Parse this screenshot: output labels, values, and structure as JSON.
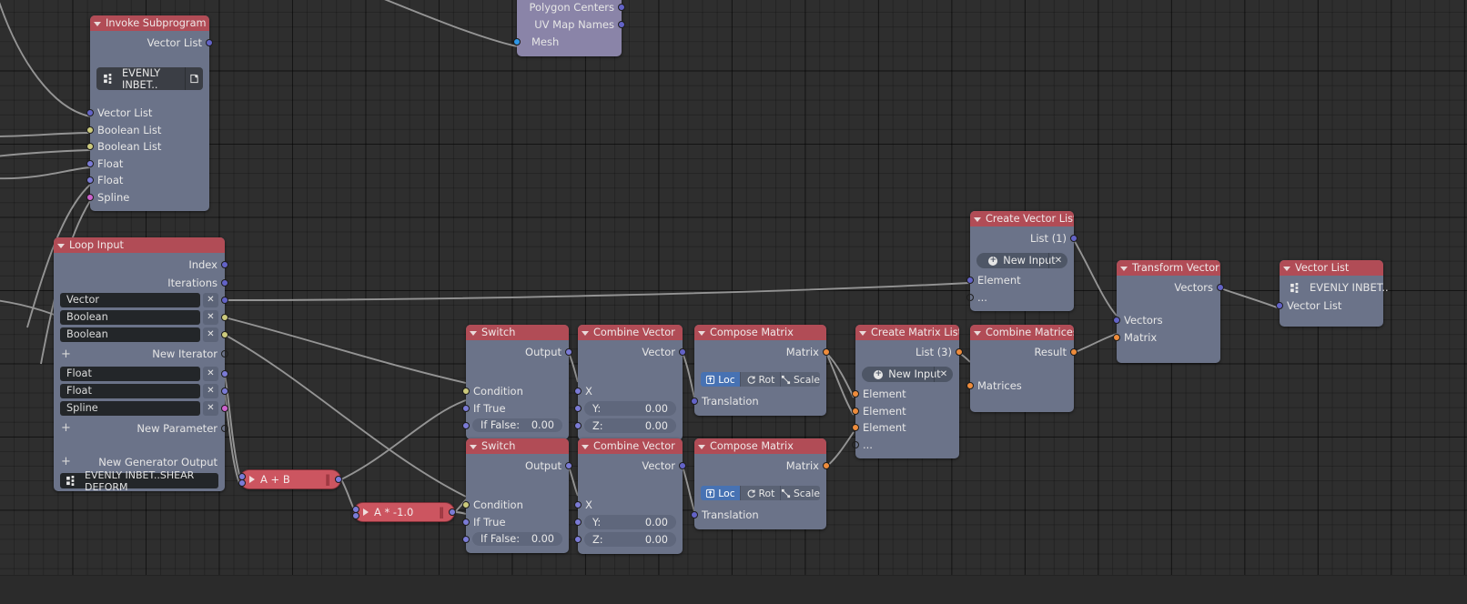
{
  "editor": {
    "name": "blender-animation-nodes-editor",
    "background_color": "#2e2e2e",
    "node_header_color": "#b14c56",
    "node_body_color": "#6b7389",
    "selected_node_body_color": "#8a84a8",
    "accent_blue": "#4772b3"
  },
  "nodes": {
    "mesh_source": {
      "title": "",
      "rows": [
        "Polygon Centers",
        "UV Map Names",
        "Mesh"
      ]
    },
    "invoke_subprogram": {
      "title": "Invoke Subprogram",
      "output": "Vector List",
      "subprogram": "EVENLY INBET..",
      "inputs": [
        "Vector List",
        "Boolean List",
        "Boolean List",
        "Float",
        "Float",
        "Spline"
      ]
    },
    "loop_input": {
      "title": "Loop Input",
      "outputs": [
        "Index",
        "Iterations"
      ],
      "iterators": [
        "Vector",
        "Boolean",
        "Boolean"
      ],
      "new_iterator": "New Iterator",
      "parameters": [
        "Float",
        "Float",
        "Spline"
      ],
      "new_parameter": "New Parameter",
      "new_generator_output": "New Generator Output",
      "footer": "EVENLY INBET..SHEAR DEFORM",
      "remove_label": "✕",
      "plus_label": "+"
    },
    "math_add": {
      "label": "A + B"
    },
    "math_mul": {
      "label": "A * -1.0"
    },
    "switch_1": {
      "title": "Switch",
      "output": "Output",
      "condition": "Condition",
      "if_true": "If True",
      "if_false_label": "If False:",
      "if_false_value": "0.00"
    },
    "switch_2": {
      "title": "Switch",
      "output": "Output",
      "condition": "Condition",
      "if_true": "If True",
      "if_false_label": "If False:",
      "if_false_value": "0.00"
    },
    "combine_vector_1": {
      "title": "Combine Vector",
      "output": "Vector",
      "x_label": "X",
      "y_label": "Y:",
      "y_value": "0.00",
      "z_label": "Z:",
      "z_value": "0.00"
    },
    "combine_vector_2": {
      "title": "Combine Vector",
      "output": "Vector",
      "x_label": "X",
      "y_label": "Y:",
      "y_value": "0.00",
      "z_label": "Z:",
      "z_value": "0.00"
    },
    "compose_matrix_1": {
      "title": "Compose Matrix",
      "output": "Matrix",
      "toggle_loc": "Loc",
      "toggle_rot": "Rot",
      "toggle_scale": "Scale",
      "input": "Translation",
      "active_toggle": "Loc"
    },
    "compose_matrix_2": {
      "title": "Compose Matrix",
      "output": "Matrix",
      "toggle_loc": "Loc",
      "toggle_rot": "Rot",
      "toggle_scale": "Scale",
      "input": "Translation",
      "active_toggle": "Loc"
    },
    "create_matrix_list": {
      "title": "Create Matrix List",
      "output": "List (3)",
      "new_input": "New Input",
      "remove_label": "✕",
      "elements": [
        "Element",
        "Element",
        "Element"
      ],
      "ellipsis": "..."
    },
    "create_vector_list": {
      "title": "Create Vector List",
      "output": "List (1)",
      "new_input": "New Input",
      "remove_label": "✕",
      "elements": [
        "Element"
      ],
      "ellipsis": "..."
    },
    "combine_matrices": {
      "title": "Combine Matrices",
      "output": "Result",
      "input": "Matrices"
    },
    "transform_vector": {
      "title": "Transform Vector",
      "output": "Vectors",
      "inputs": [
        "Vectors",
        "Matrix"
      ]
    },
    "vector_list": {
      "title": "Vector List",
      "subprogram": "EVENLY INBET..",
      "input": "Vector List"
    }
  }
}
